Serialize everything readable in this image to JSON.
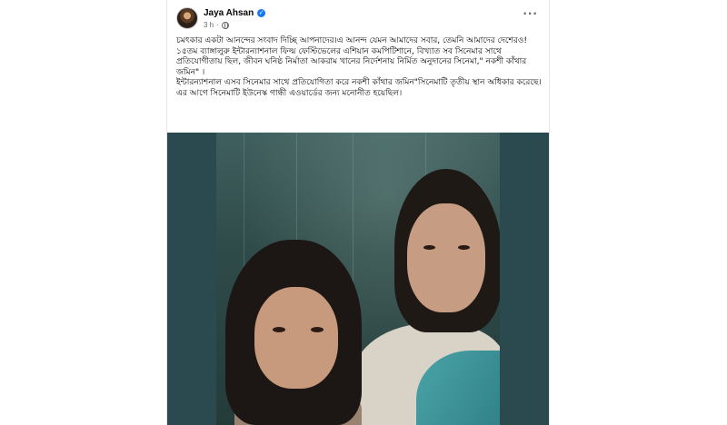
{
  "post": {
    "author": "Jaya Ahsan",
    "time": "3 h",
    "more_label": "···",
    "paragraphs": [
      "চমৎকার একটা আনন্দের সংবাদ দিচ্ছি আপনাদের।এ আনন্দ যেমন আমাদের সবার, তেমনি আমাদের দেশেরও!",
      "১৫তম ব্যাঙ্গালুরু ইন্টারন্যাশনাল ফিল্ম ফেস্টিভেলের এশিয়ান কমপিটিশানে, বিখ্যাত সব সিনেমার সাথে প্রতিযোগীতায় ছিল, জীবন ঘনিষ্ঠ নির্মাতা আকরাম খানের নির্দেশনায় নির্মিত অনুদানের সিনেমা,\" নকশী কাঁথার জমিন\" ।",
      "ইন্টারন্যাশনাল এসব সিনেমার সাথে প্রতিযোগিতা করে নকশী কাঁথার জমিন\"সিনেমাটি তৃতীয় স্থান অধিকার করেছে।",
      "এর আগে সিনেমাটি ইউনেস্ক গান্ধী এওয়ার্ডের জন্য মনোনীত হয়েছিল।"
    ]
  },
  "colors": {
    "verified_badge": "#1877f2",
    "photo_background": "#2b4a50"
  },
  "icons": [
    "avatar",
    "verified-badge-icon",
    "globe-icon",
    "more-options-icon"
  ]
}
